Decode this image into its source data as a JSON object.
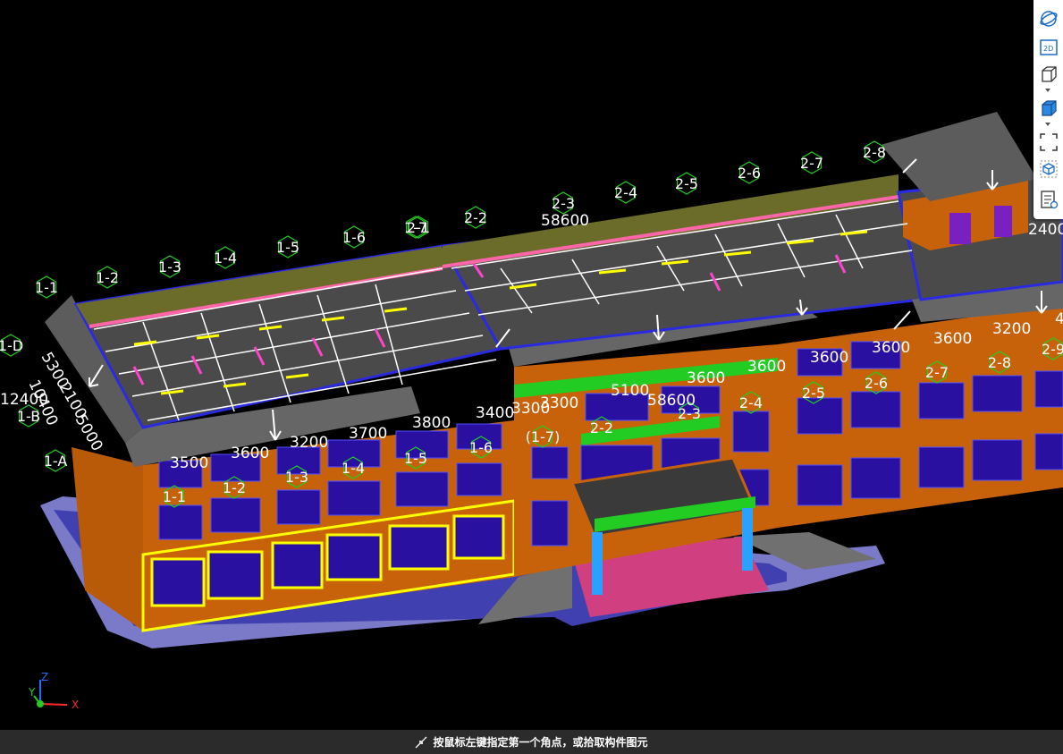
{
  "colors": {
    "background": "#000000",
    "wall": "#c8620a",
    "window": "#2a10a0",
    "roof": "#5a5a5a",
    "accent_yellow": "#ffff00",
    "accent_green": "#22cc22",
    "accent_blue": "#2a2ae0",
    "accent_pink": "#e04090",
    "status_bar": "#2b2b2b"
  },
  "axis_labels": {
    "grid_1": [
      "1-1",
      "1-2",
      "1-3",
      "1-4",
      "1-5",
      "1-6",
      "1-7"
    ],
    "grid_2": [
      "2-1",
      "2-2",
      "2-3",
      "2-4",
      "2-5",
      "2-6",
      "2-7",
      "2-8"
    ],
    "grid_letters": [
      "1-D",
      "1-B",
      "1-A"
    ],
    "wall_grid_1": [
      "1-1",
      "1-2",
      "1-3",
      "1-4",
      "1-5",
      "1-6",
      "(1-7)"
    ],
    "wall_grid_2": [
      "2-2",
      "2-3",
      "2-4",
      "2-5",
      "2-6",
      "2-7",
      "2-8",
      "2-9"
    ]
  },
  "dimensions": {
    "total_top": "58600",
    "total_mid": "58600",
    "left_total": "12400",
    "left_stack": [
      "5300",
      "2100",
      "5000"
    ],
    "left_partial": "10400",
    "spans_front": [
      "3500",
      "3600",
      "3200",
      "3700",
      "3800",
      "3400",
      "3300",
      "3300"
    ],
    "spans_mid": [
      "5100",
      "3600",
      "3600",
      "3600",
      "3600",
      "3600",
      "3200",
      "4"
    ],
    "right_edge": "2400"
  },
  "toolbar": {
    "buttons": [
      {
        "name": "orbit-icon",
        "label": ""
      },
      {
        "name": "view-2d-icon",
        "label": "2D"
      },
      {
        "name": "view-3d-box-icon",
        "label": ""
      },
      {
        "name": "solid-box-icon",
        "label": ""
      },
      {
        "name": "fit-extent-icon",
        "label": ""
      },
      {
        "name": "component-cube-icon",
        "label": ""
      },
      {
        "name": "properties-icon",
        "label": ""
      }
    ]
  },
  "triad": {
    "x": "X",
    "y": "Y",
    "z": "Z"
  },
  "status": {
    "message": "按鼠标左键指定第一个角点，或拾取构件图元"
  }
}
